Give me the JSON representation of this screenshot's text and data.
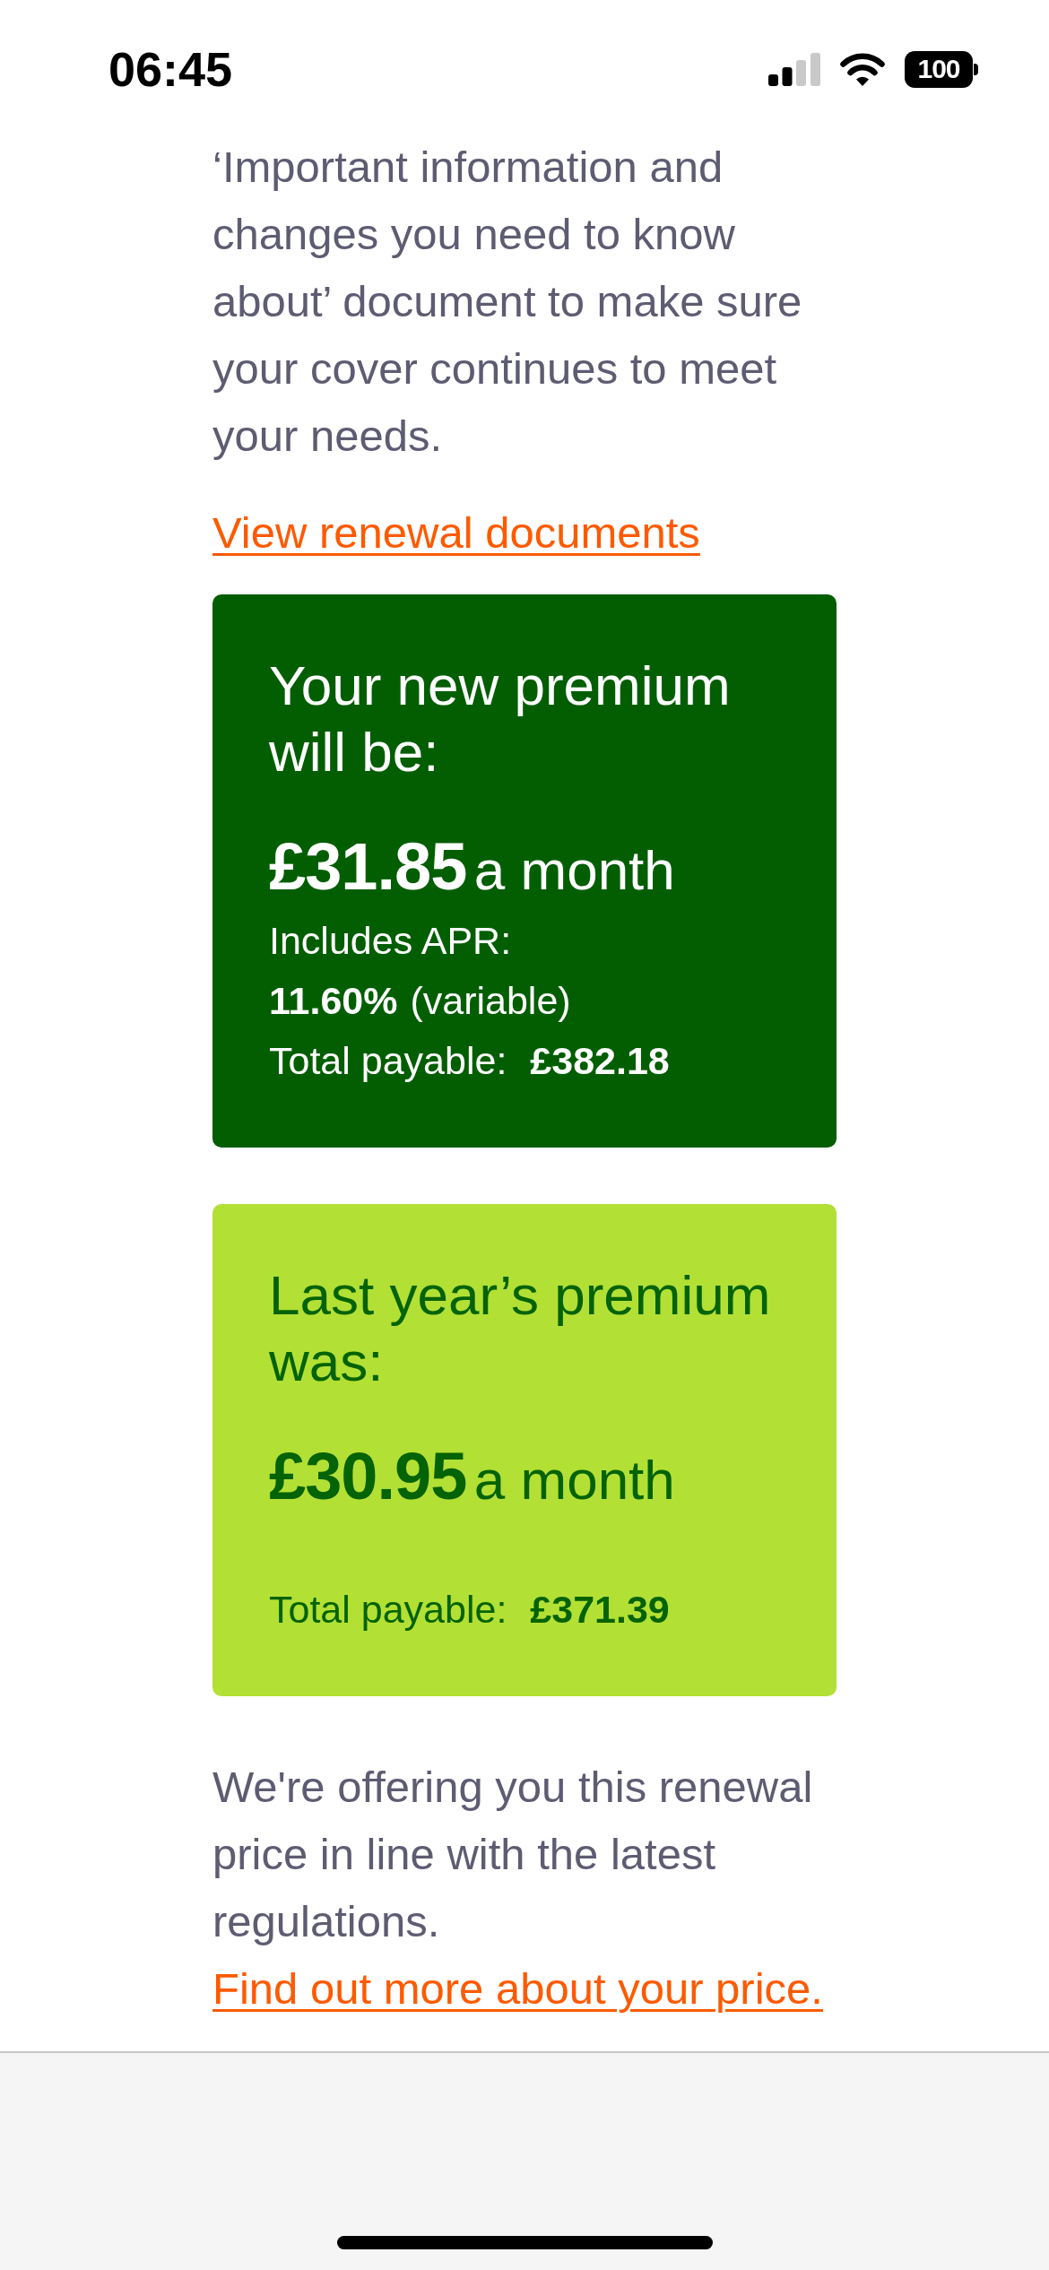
{
  "status_bar": {
    "time": "06:45",
    "battery": "100"
  },
  "intro": "‘Important information and changes you need to know about’ document to make sure your cover continues to meet your needs.",
  "renewal_link": "View renewal documents",
  "premium_cards": [
    {
      "kind": "new",
      "title": "Your new premium will be:",
      "amount": "£31.85",
      "period": "a month",
      "apr": {
        "label": "Includes APR:",
        "rate": "11.60%",
        "type": "(variable)"
      },
      "total_label": "Total payable:",
      "total_amount": "£382.18"
    },
    {
      "kind": "previous",
      "title": "Last year’s premium was:",
      "amount": "£30.95",
      "period": "a month",
      "total_label": "Total payable:",
      "total_amount": "£371.39"
    }
  ],
  "price_note": {
    "text": "We're offering you this renewal price in line with the latest regulations.",
    "link": "Find out more about your price."
  }
}
